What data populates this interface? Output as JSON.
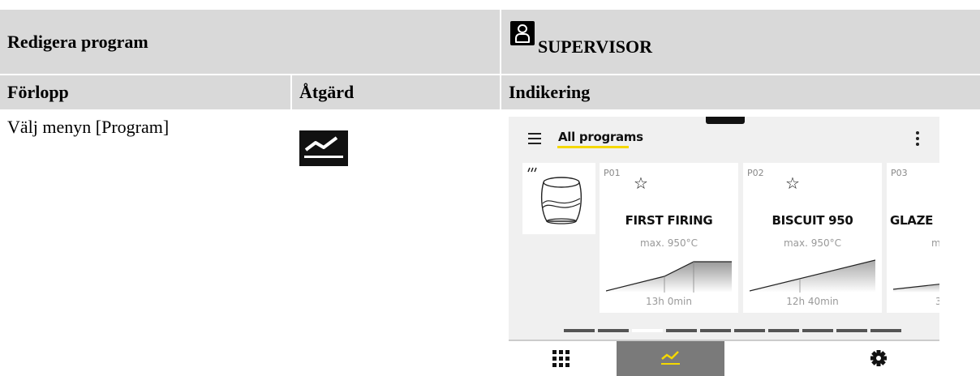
{
  "table": {
    "title": "Redigera program",
    "role_label": "SUPERVISOR",
    "columns": [
      "Förlopp",
      "Åtgärd",
      "Indikering"
    ],
    "row": {
      "step_text": "Välj menyn [Program]"
    }
  },
  "device": {
    "header": {
      "title": "All programs"
    },
    "programs": [
      {
        "id": "P01",
        "name": "FIRST FIRING",
        "max_temp": "max. 950°C",
        "duration": "13h 0min"
      },
      {
        "id": "P02",
        "name": "BISCUIT 950",
        "max_temp": "max. 950°C",
        "duration": "12h 40min"
      },
      {
        "id": "P03",
        "name": "GLAZE",
        "max_temp": "m",
        "duration": "3"
      }
    ],
    "pager": {
      "active_page": 2,
      "total_pages": 10
    },
    "bottom_nav": {
      "items": [
        "apps",
        "programs",
        "settings"
      ],
      "active": "programs"
    },
    "colors": {
      "accent": "#f5d800",
      "active_nav": "#7a7a7a",
      "screen_bg": "#f0f0f0"
    }
  }
}
